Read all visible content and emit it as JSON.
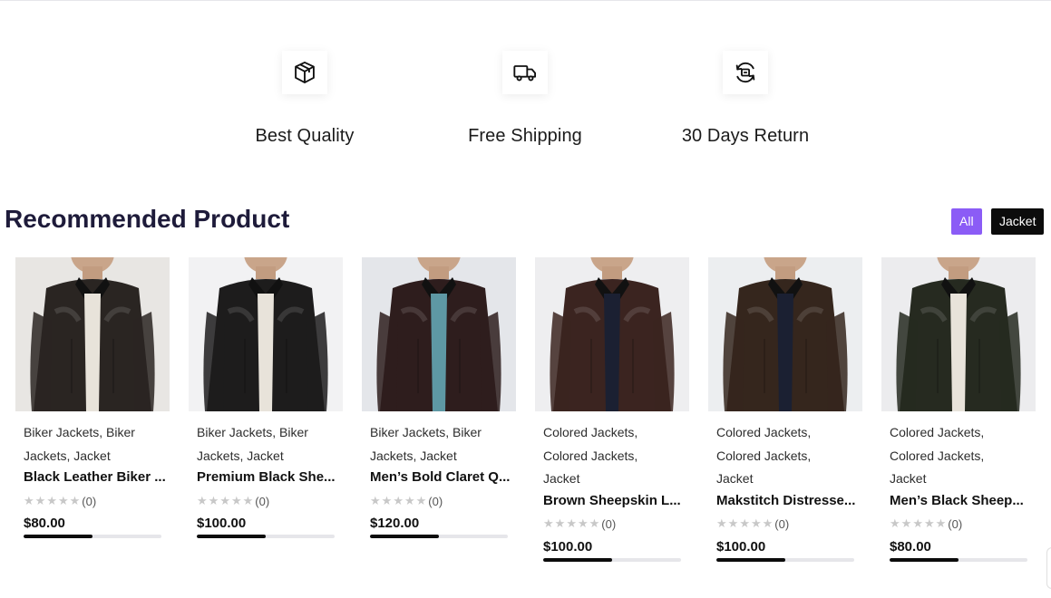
{
  "features": [
    {
      "label": "Best Quality",
      "icon": "box-icon"
    },
    {
      "label": "Free Shipping",
      "icon": "truck-icon"
    },
    {
      "label": "30 Days Return",
      "icon": "return-icon"
    }
  ],
  "section": {
    "title": "Recommended Product"
  },
  "filters": {
    "all": "All",
    "jacket": "Jacket"
  },
  "colors": {
    "accent": "#8b5cf6",
    "dark": "#0c0c0c",
    "heading": "#1e1b3a"
  },
  "products": [
    {
      "categories": [
        "Biker Jackets,",
        "Biker",
        "Jackets,",
        "Jacket"
      ],
      "cat_lines": [
        "Biker Jackets, Biker",
        "Jackets, Jacket"
      ],
      "name": "Black Leather Biker ...",
      "rating_count": "(0)",
      "price": "$80.00",
      "progress": 0.5,
      "jacket_color": "#2a2522"
    },
    {
      "cat_lines": [
        "Biker Jackets, Biker",
        "Jackets, Jacket"
      ],
      "name": "Premium Black She...",
      "rating_count": "(0)",
      "price": "$100.00",
      "progress": 0.5,
      "jacket_color": "#1d1c1c"
    },
    {
      "cat_lines": [
        "Biker Jackets, Biker",
        "Jackets, Jacket"
      ],
      "name": "Men’s Bold Claret Q...",
      "rating_count": "(0)",
      "price": "$120.00",
      "progress": 0.5,
      "jacket_color": "#2e1d1d"
    },
    {
      "cat_lines": [
        "Colored Jackets,",
        "Colored Jackets,",
        "Jacket"
      ],
      "name": "Brown Sheepskin L...",
      "rating_count": "(0)",
      "price": "$100.00",
      "progress": 0.5,
      "jacket_color": "#3b2420"
    },
    {
      "cat_lines": [
        "Colored Jackets,",
        "Colored Jackets,",
        "Jacket"
      ],
      "name": "Makstitch Distresse...",
      "rating_count": "(0)",
      "price": "$100.00",
      "progress": 0.5,
      "jacket_color": "#35261d"
    },
    {
      "cat_lines": [
        "Colored Jackets,",
        "Colored Jackets,",
        "Jacket"
      ],
      "name": "Men’s Black Sheep...",
      "rating_count": "(0)",
      "price": "$80.00",
      "progress": 0.5,
      "jacket_color": "#262a20"
    }
  ]
}
